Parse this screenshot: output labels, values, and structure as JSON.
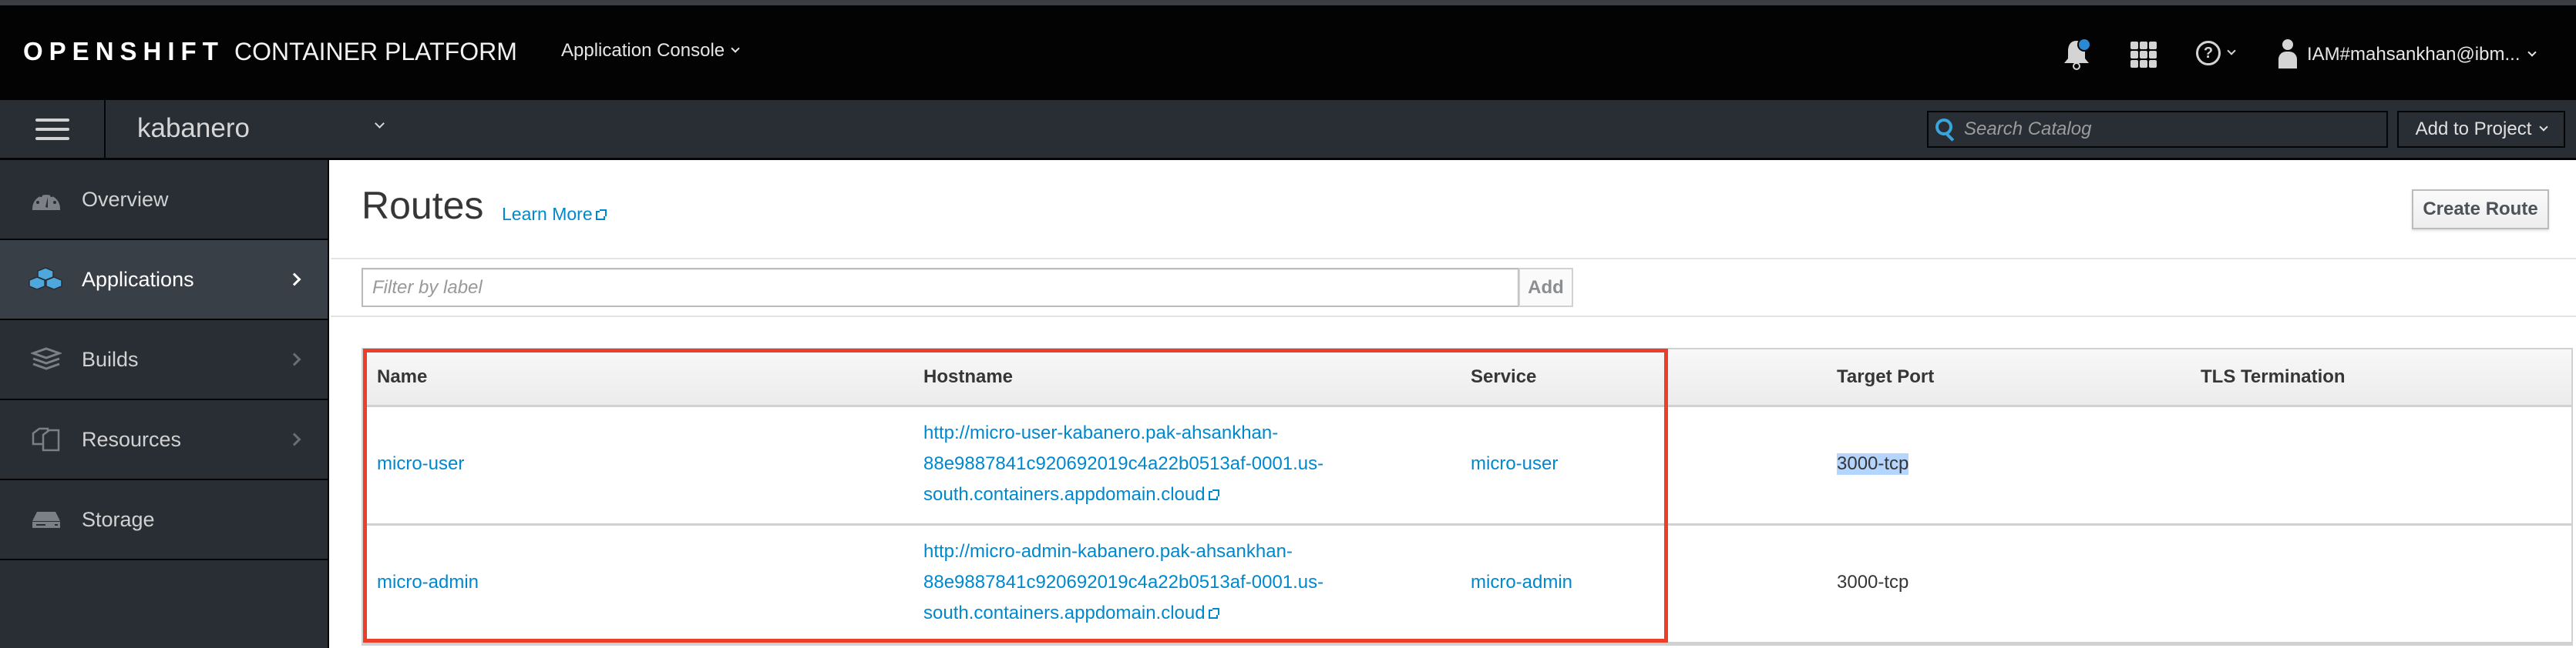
{
  "masthead": {
    "brand_bold": "OPENSHIFT",
    "brand_light": "CONTAINER PLATFORM",
    "console_switcher": "Application Console",
    "notification_badge_color": "#2b89d4",
    "user_label": "IAM#mahsankhan@ibm..."
  },
  "projectbar": {
    "project_name": "kabanero",
    "search_placeholder": "Search Catalog",
    "add_to_project": "Add to Project"
  },
  "sidebar": {
    "items": [
      {
        "label": "Overview",
        "icon": "dashboard-icon",
        "active": false,
        "has_children": false
      },
      {
        "label": "Applications",
        "icon": "cubes-icon",
        "active": true,
        "has_children": true
      },
      {
        "label": "Builds",
        "icon": "layers-icon",
        "active": false,
        "has_children": true
      },
      {
        "label": "Resources",
        "icon": "files-icon",
        "active": false,
        "has_children": true
      },
      {
        "label": "Storage",
        "icon": "storage-icon",
        "active": false,
        "has_children": false
      }
    ]
  },
  "main": {
    "title": "Routes",
    "learn_more": "Learn More",
    "create_route": "Create Route",
    "filter_placeholder": "Filter by label",
    "add_label": "Add",
    "table": {
      "columns": [
        "Name",
        "Hostname",
        "Service",
        "Target Port",
        "TLS Termination"
      ],
      "rows": [
        {
          "name": "micro-user",
          "hostname_lines": [
            "http://micro-user-kabanero.pak-ahsankhan-",
            "88e9887841c920692019c4a22b0513af-0001.us-",
            "south.containers.appdomain.cloud"
          ],
          "service": "micro-user",
          "target_port": "3000-tcp",
          "tls_termination": ""
        },
        {
          "name": "micro-admin",
          "hostname_lines": [
            "http://micro-admin-kabanero.pak-ahsankhan-",
            "88e9887841c920692019c4a22b0513af-0001.us-",
            "south.containers.appdomain.cloud"
          ],
          "service": "micro-admin",
          "target_port": "3000-tcp",
          "tls_termination": ""
        }
      ]
    },
    "highlight_color": "#ec3f2b",
    "accent_color": "#0088ce"
  }
}
